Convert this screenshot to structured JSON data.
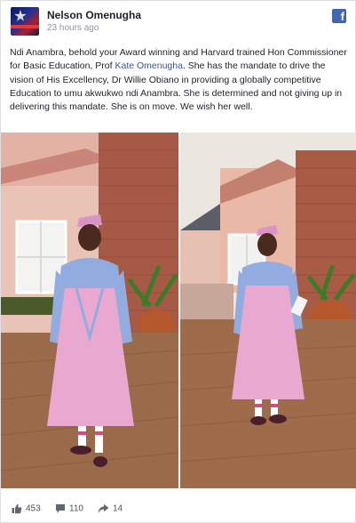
{
  "post": {
    "author": "Nelson Omenugha",
    "time": "23 hours ago",
    "text_part1": "Ndi Anambra, behold your Award winning and Harvard trained Hon Commissioner for Basic Education, Prof ",
    "text_link": "Kate Omenugha",
    "text_part2": ". She has the mandate to drive the vision of His Excellency, Dr Willie Obiano in providing a globally competitive Education to umu akwukwo ndi Anambra. She is determined and not giving up in delivering this mandate. She is on move. We wish her well.",
    "platform_icon": "facebook-icon"
  },
  "stats": {
    "likes": "453",
    "comments": "110",
    "shares": "14"
  },
  "colors": {
    "link": "#365899",
    "facebook": "#4267b2",
    "dress_pink": "#e9a8cf",
    "cape_blue": "#8ea8de"
  }
}
